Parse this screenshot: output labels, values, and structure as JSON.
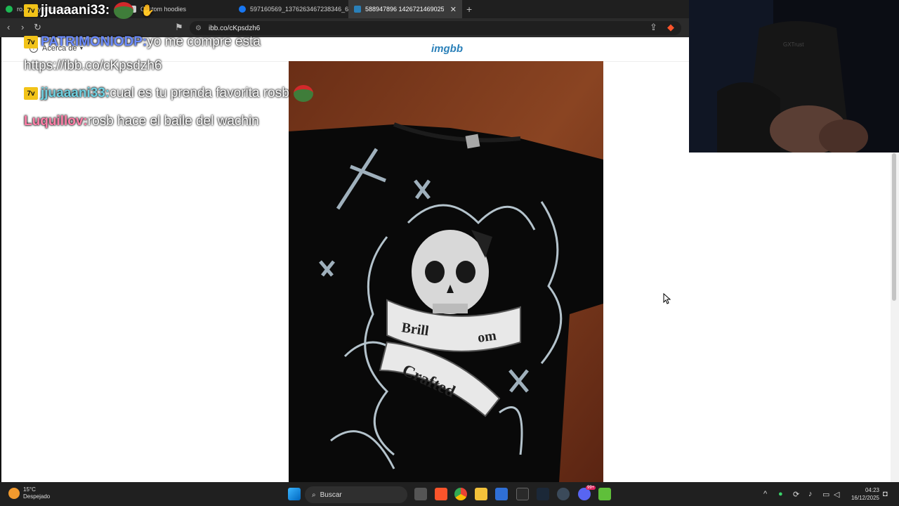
{
  "browser": {
    "tabs": [
      {
        "label": "ro... playlist by rosb",
        "favicon_color": "#1db954"
      },
      {
        "label": "Custom hoodies",
        "favicon_color": "#cccccc"
      },
      {
        "label": "597160569_1376263467238346_678...",
        "favicon_color": "#1877f2"
      },
      {
        "label": "588947896 1426721469025132...",
        "favicon_color": "#2a80b9"
      }
    ],
    "url": "ibb.co/cKpsdzh6"
  },
  "imgbb": {
    "about_label": "Acerca de",
    "logo": "imgbb",
    "print_top": "Brill",
    "print_top_right": "om",
    "print_bottom": "Crafted"
  },
  "chat": [
    {
      "user": "jjuaaani33:",
      "text": "",
      "user_color": "#ffffff",
      "emote": "peepo-santa"
    },
    {
      "user": "PATRIMONIODP:",
      "text": " yo me compre esta",
      "user_color": "#6c8cff"
    },
    {
      "user": "",
      "text": "https://ibb.co/cKpsdzh6",
      "user_color": "#ffffff"
    },
    {
      "user": "jjuaaani33:",
      "text": " cual es tu prenda favorita rosb",
      "user_color": "#6fd0e0",
      "emote": "peepo-santa"
    },
    {
      "user": "Luquillov:",
      "text": " rosb hace el baile del wachin",
      "user_color": "#ff7fa8"
    }
  ],
  "webcam": {
    "mic_brand": "GXTrust"
  },
  "taskbar": {
    "weather_temp": "15°C",
    "weather_desc": "Despejado",
    "search_label": "Buscar",
    "time": "04:23",
    "date": "16/12/2025",
    "steam_badge": "99+"
  }
}
